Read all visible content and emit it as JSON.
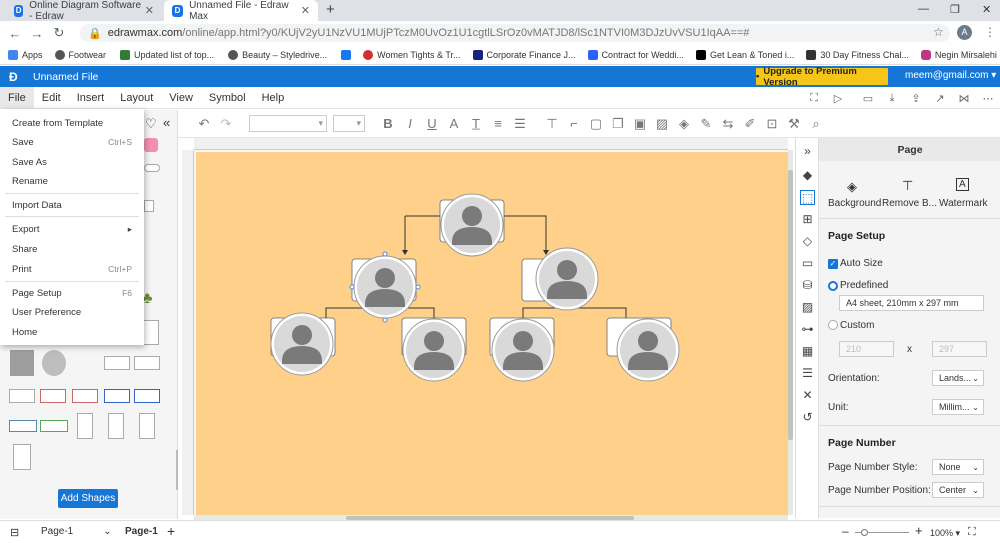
{
  "browser": {
    "tabs": [
      {
        "title": "Online Diagram Software - Edraw",
        "active": false
      },
      {
        "title": "Unnamed File - Edraw Max",
        "active": true
      }
    ],
    "new_tab": "+",
    "url_host": "edrawmax.com",
    "url_path": "/online/app.html?y0/KUjV2yU1NzVU1MUjPTczM0UvOz1U1cgtlLSrOz0vMATJD8/lSc1NTVI0M3DJzUvVSU1IqAA==#",
    "profile_initial": "A",
    "bookmarks": [
      "Apps",
      "Footwear",
      "Updated list of top...",
      "Beauty – Styledrive...",
      "Women Tights & Tr...",
      "Corporate Finance J...",
      "Contract for Weddi...",
      "Get Lean & Toned i...",
      "30 Day Fitness Chal...",
      "Negin Mirsalehi (@..."
    ]
  },
  "app": {
    "file_title": "Unnamed File",
    "upgrade_label": "Upgrade to Premium Version",
    "user_email": "meem@gmail.com",
    "menu": [
      "File",
      "Edit",
      "Insert",
      "Layout",
      "View",
      "Symbol",
      "Help"
    ]
  },
  "file_menu": {
    "items": [
      {
        "label": "Create from Template",
        "shortcut": ""
      },
      {
        "label": "Save",
        "shortcut": "Ctrl+S"
      },
      {
        "label": "Save As",
        "shortcut": ""
      },
      {
        "label": "Rename",
        "shortcut": ""
      },
      {
        "label": "Import Data",
        "shortcut": ""
      },
      {
        "label": "Export",
        "shortcut": "▸"
      },
      {
        "label": "Share",
        "shortcut": ""
      },
      {
        "label": "Print",
        "shortcut": "Ctrl+P"
      },
      {
        "label": "Page Setup",
        "shortcut": "F6"
      },
      {
        "label": "User Preference",
        "shortcut": ""
      },
      {
        "label": "Home",
        "shortcut": ""
      }
    ]
  },
  "library": {
    "add_shapes": "Add Shapes"
  },
  "right_panel": {
    "title": "Page",
    "tools": [
      "Background",
      "Remove B...",
      "Watermark"
    ],
    "page_setup": "Page Setup",
    "auto_size": "Auto Size",
    "predefined": "Predefined",
    "paper": "A4 sheet, 210mm x 297 mm",
    "custom": "Custom",
    "width_val": "210",
    "x_sep": "x",
    "height_val": "297",
    "orientation_label": "Orientation:",
    "orientation_val": "Lands...",
    "unit_label": "Unit:",
    "unit_val": "Millim...",
    "page_number_title": "Page Number",
    "page_number_style_label": "Page Number Style:",
    "page_number_style_val": "None",
    "page_number_position_label": "Page Number Position:",
    "page_number_position_val": "Center"
  },
  "statusbar": {
    "page_select": "Page-1",
    "page_tab": "Page-1",
    "add_page": "+",
    "zoom": "100%"
  },
  "colors": {
    "brand": "#1676d6",
    "upgrade": "#f5c518",
    "page_bg": "#ffd08a",
    "avatar": "#7a7a7a"
  }
}
